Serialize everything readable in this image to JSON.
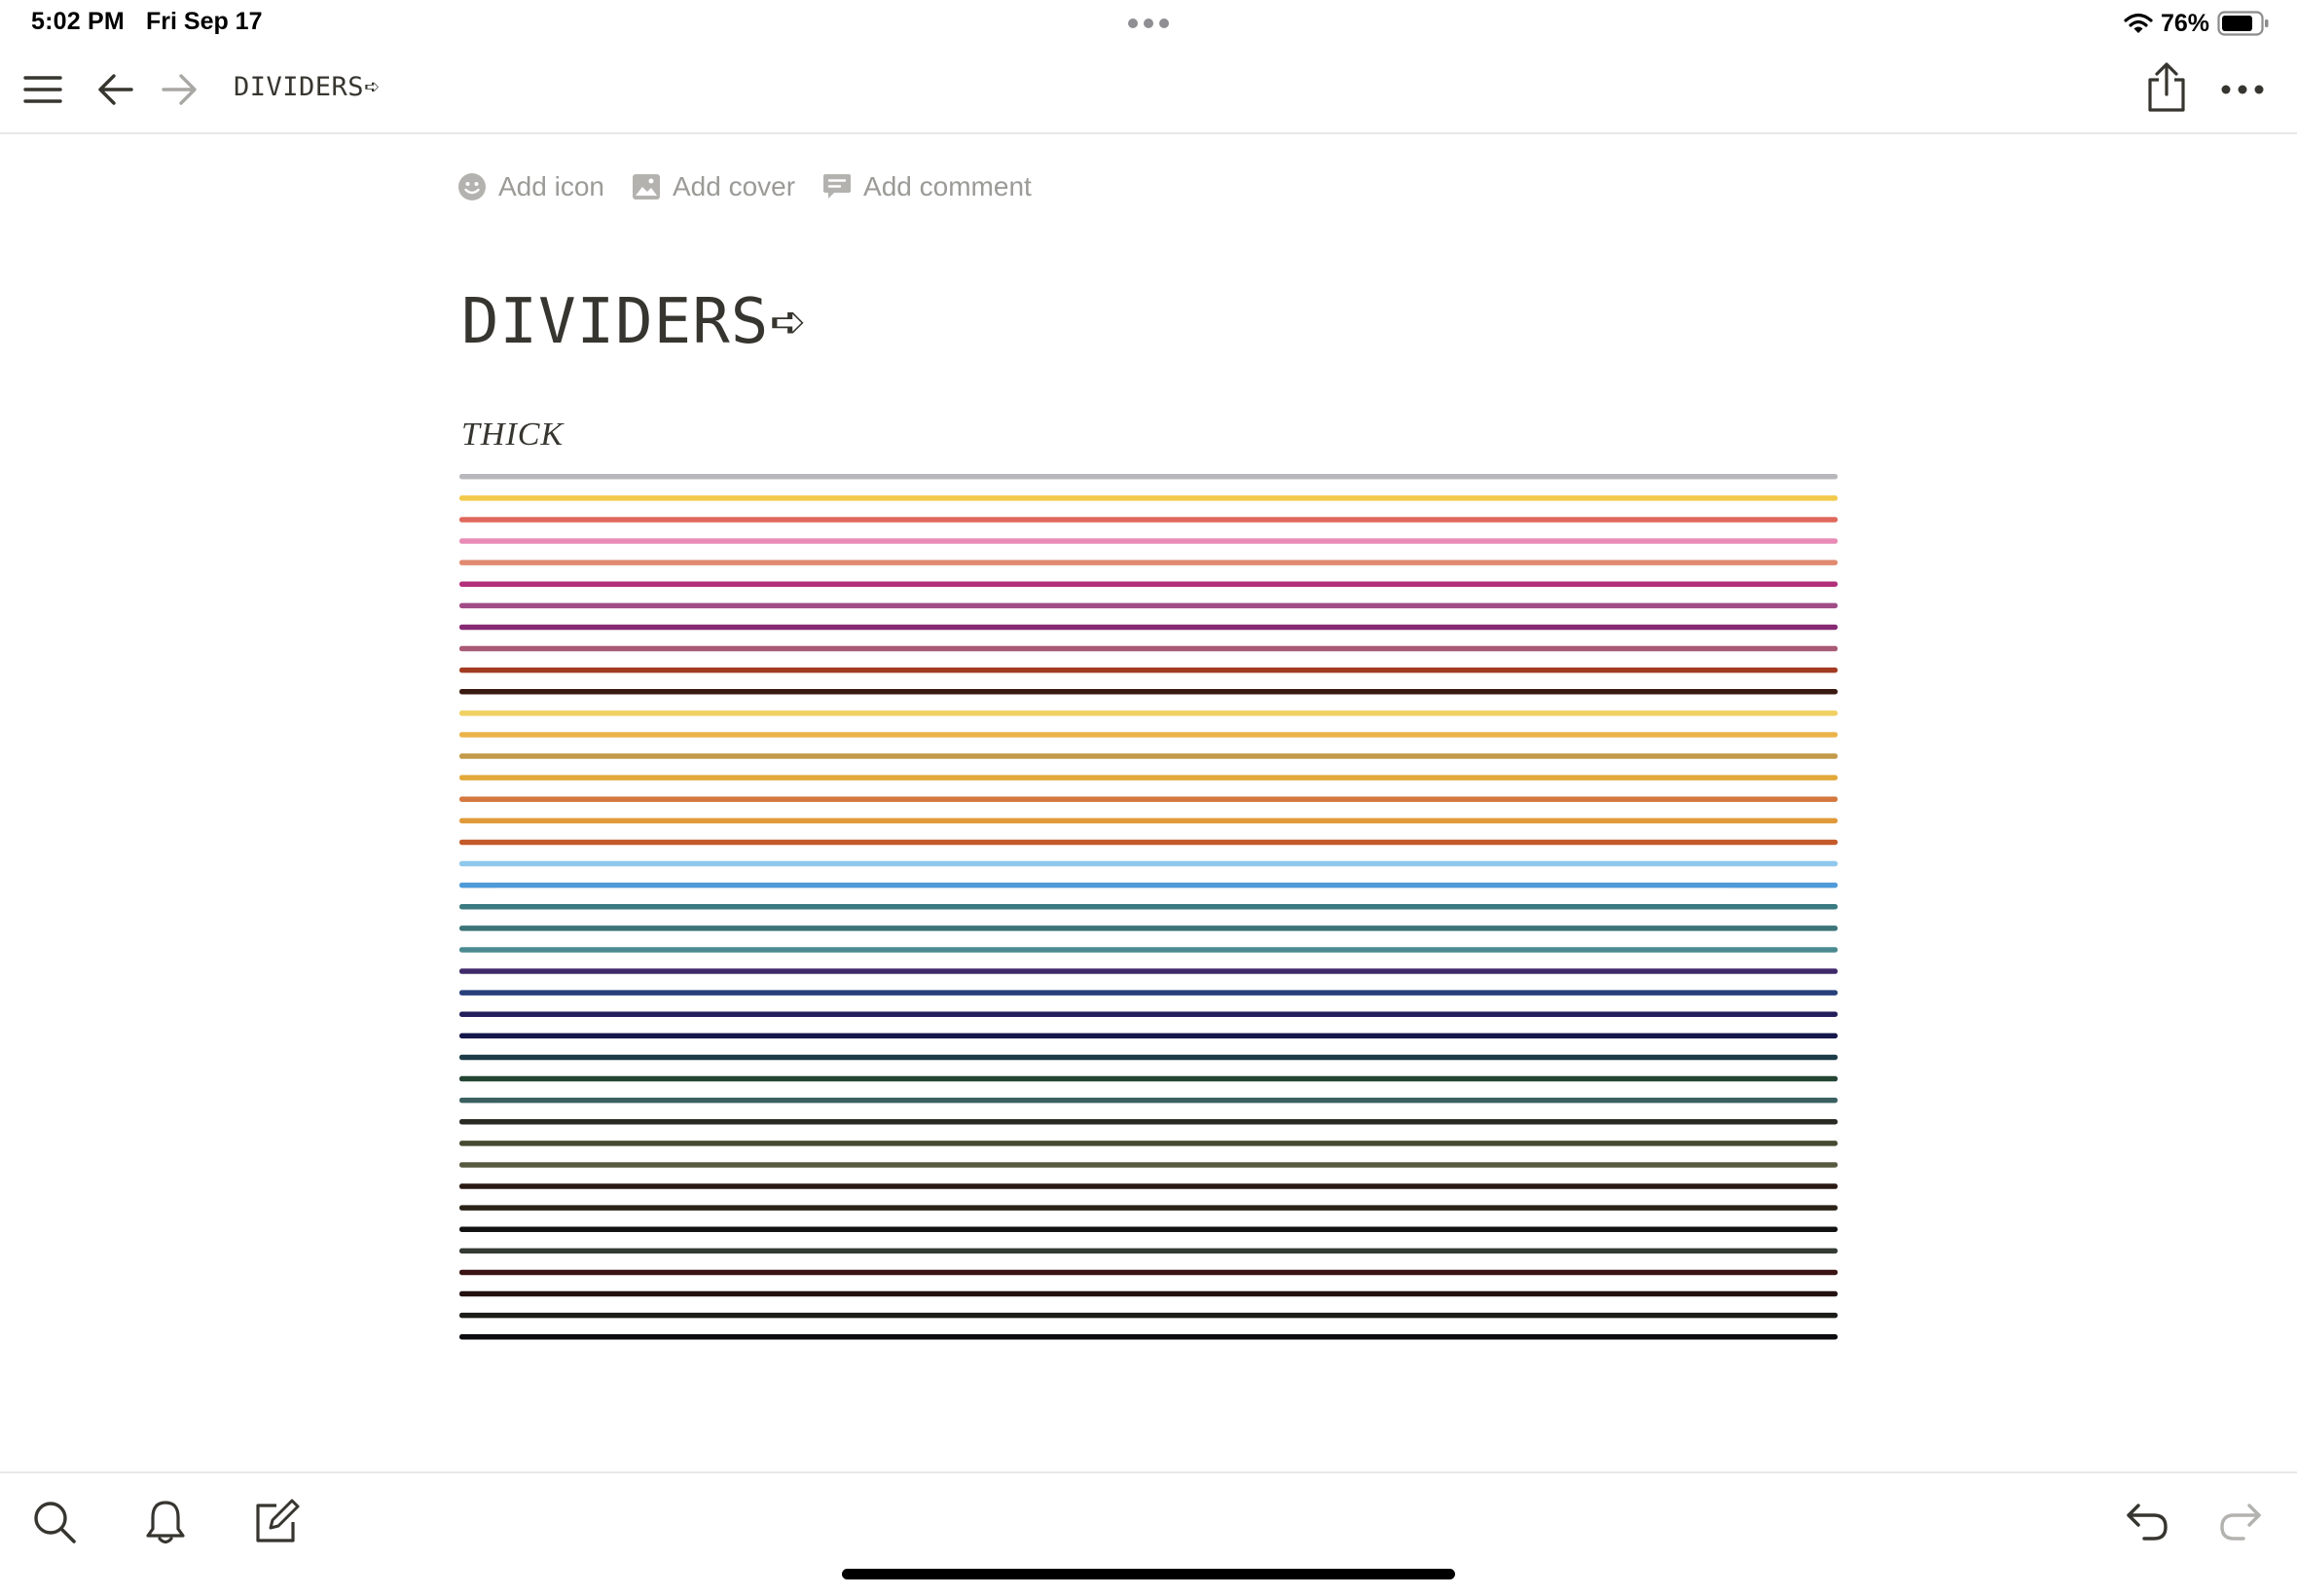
{
  "status_bar": {
    "time": "5:02 PM",
    "date": "Fri Sep 17",
    "battery": "76%"
  },
  "toolbar": {
    "breadcrumb": "DIVIDERS➪",
    "icons": [
      "menu-icon",
      "back-arrow-icon",
      "forward-arrow-icon",
      "share-icon",
      "more-icon"
    ]
  },
  "page": {
    "actions": {
      "add_icon": "Add icon",
      "add_cover": "Add cover",
      "add_comment": "Add comment"
    },
    "title": "DIVIDERS➪",
    "section_heading": "THICK",
    "dividers": {
      "style": "thick",
      "colors": [
        "#b8b8bc",
        "#f2c94c",
        "#e0685c",
        "#e88bb5",
        "#e08a70",
        "#b3307a",
        "#a04d86",
        "#862a73",
        "#a85a76",
        "#a23b22",
        "#3a1a10",
        "#f0d060",
        "#ebb44a",
        "#c29a4a",
        "#e2a83a",
        "#d47840",
        "#e09a3a",
        "#c45a2a",
        "#90c8ec",
        "#4f9ad8",
        "#3a7a80",
        "#3c7478",
        "#4a8a90",
        "#3f2a6a",
        "#27407c",
        "#241f5a",
        "#15174a",
        "#1c3a48",
        "#244434",
        "#3a6060",
        "#2a2a24",
        "#474a30",
        "#585a40",
        "#2a1a14",
        "#2a2218",
        "#121212",
        "#343a34",
        "#3a1414",
        "#241010",
        "#1c1c18",
        "#0c0c10"
      ]
    }
  },
  "bottom_bar": {
    "icons": [
      "search-icon",
      "bell-icon",
      "compose-icon",
      "undo-icon",
      "redo-icon"
    ]
  }
}
